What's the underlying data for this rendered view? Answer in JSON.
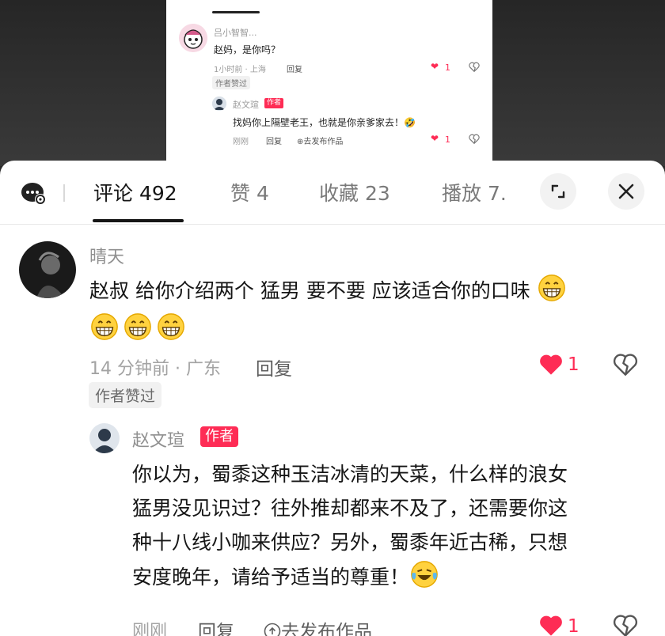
{
  "inset": {
    "comment1": {
      "name": "吕小智智...",
      "text": "赵妈，是你吗？",
      "time_location": "1小时前 · 上海",
      "reply_label": "回复",
      "liked_badge": "作者赞过",
      "like_count": "1"
    },
    "reply1": {
      "name": "赵文瑄",
      "author_tag": "作者",
      "text": "找妈你上隔壁老王，也就是你亲爹家去！",
      "time": "刚刚",
      "reply_label": "回复",
      "publish_label": "去发布作品",
      "like_count": "1"
    }
  },
  "header": {
    "tabs": [
      {
        "label": "评论 492",
        "active": true
      },
      {
        "label": "赞 4"
      },
      {
        "label": "收藏 23"
      },
      {
        "label": "播放 7."
      }
    ],
    "icons": [
      "comment-settings-icon",
      "expand-icon",
      "close-icon"
    ]
  },
  "comment": {
    "name": "晴天",
    "text_line1": "赵叔 给你介绍两个 猛男 要不要 应该适合你的口味",
    "time_location": "14 分钟前 · 广东",
    "reply_label": "回复",
    "like_count": "1",
    "liked_badge": "作者赞过"
  },
  "reply": {
    "name": "赵文瑄",
    "author_tag": "作者",
    "lines": [
      "你以为，蜀黍这种玉洁冰清的天菜，什么样的浪女",
      "猛男没见识过？往外推却都来不及了，还需要你这",
      "种十八线小咖来供应？另外，蜀黍年近古稀，只想",
      "安度晚年，请给予适当的尊重！"
    ],
    "time": "刚刚",
    "reply_label": "回复",
    "publish_label": "去发布作品",
    "like_count": "1"
  },
  "colors": {
    "accent": "#fe2c55",
    "text": "#161616",
    "muted": "#a3a3a3"
  }
}
